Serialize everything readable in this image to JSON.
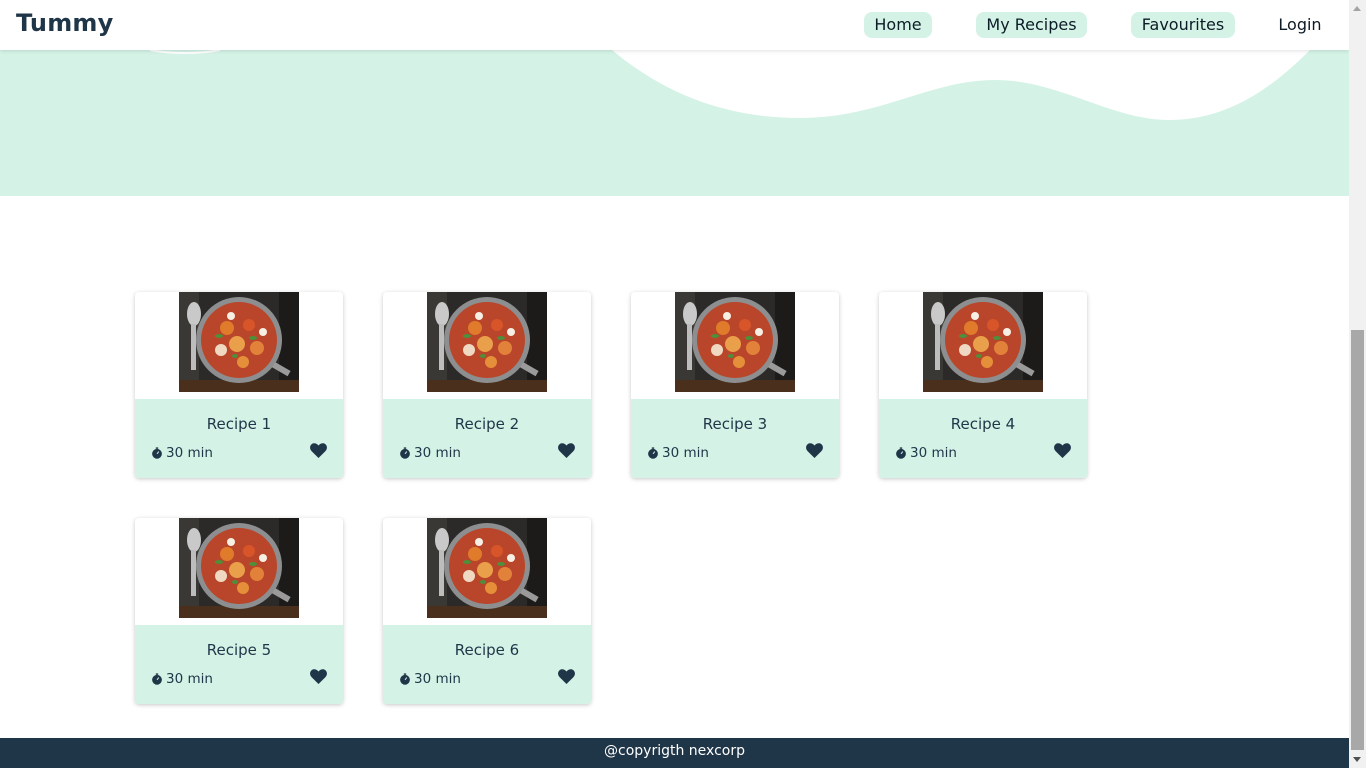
{
  "header": {
    "logo": "Tummy",
    "nav": [
      {
        "label": "Home",
        "pill": true
      },
      {
        "label": "My Recipes",
        "pill": true
      },
      {
        "label": "Favourites",
        "pill": true
      },
      {
        "label": "Login",
        "pill": false
      }
    ]
  },
  "recipes": [
    {
      "title": "Recipe 1",
      "time": "30 min"
    },
    {
      "title": "Recipe 2",
      "time": "30 min"
    },
    {
      "title": "Recipe 3",
      "time": "30 min"
    },
    {
      "title": "Recipe 4",
      "time": "30 min"
    },
    {
      "title": "Recipe 5",
      "time": "30 min"
    },
    {
      "title": "Recipe 6",
      "time": "30 min"
    }
  ],
  "footer": {
    "text": "@copyrigth nexcorp"
  },
  "colors": {
    "accent": "#d4f3e6",
    "dark": "#1f3548",
    "white": "#ffffff"
  },
  "icons": {
    "timer": "timer-icon",
    "favourite": "heart-icon",
    "food": "food-image"
  }
}
